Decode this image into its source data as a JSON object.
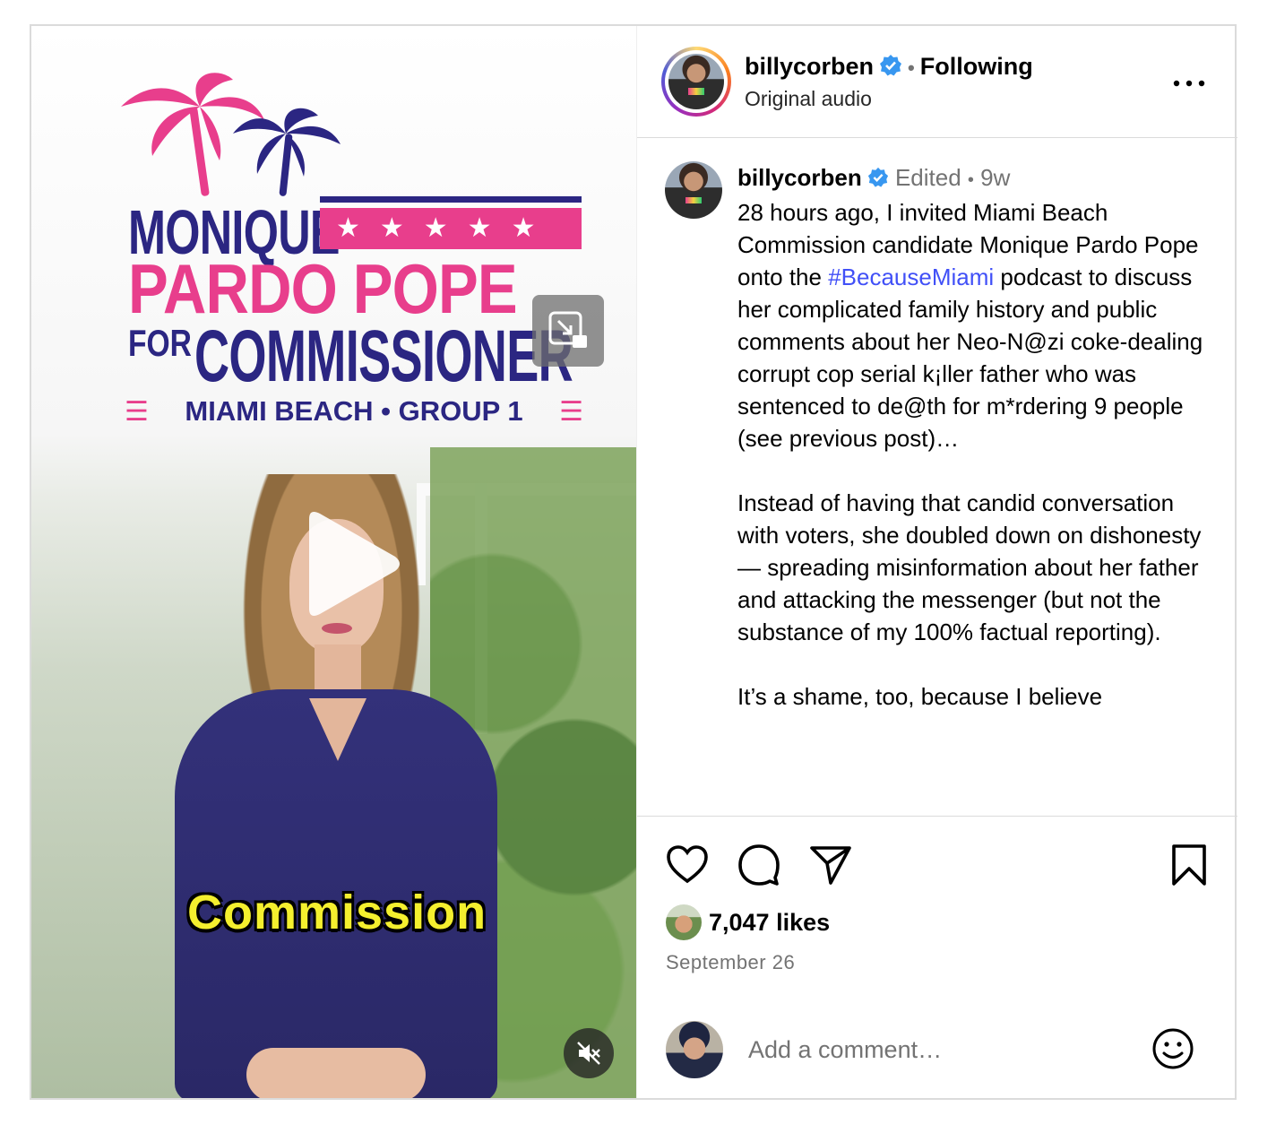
{
  "media": {
    "poster": {
      "line1": "MONIQUE",
      "stars": "★★★★★",
      "line2": "PARDO POPE",
      "line3a": "FOR",
      "line3b": "COMMISSIONER",
      "line4_left": "☰",
      "line4": "MIAMI BEACH • GROUP 1",
      "line4_right": "☰"
    },
    "caption_overlay": "Commission",
    "colors": {
      "navy": "#2b2682",
      "pink": "#e83e8c",
      "caption_yellow": "#f4ef2e"
    }
  },
  "header": {
    "username": "billycorben",
    "separator": "•",
    "follow_status": "Following",
    "audio": "Original audio",
    "more_icon": "more-horizontal-icon"
  },
  "caption": {
    "username": "billycorben",
    "edited": "Edited",
    "separator": "•",
    "age": "9w",
    "para1_before": "28 hours ago, I invited Miami Beach Commission candidate Monique Pardo Pope onto the ",
    "hashtag": "#BecauseMiami",
    "para1_after": " podcast to discuss her complicated family history and public comments about her Neo-N@zi coke-dealing corrupt cop serial k¡ller father who was sentenced to de@th for m*rdering 9 people (see previous post)…",
    "para2": "Instead of having that candid conversation with voters, she doubled down on dishonesty — spreading misinformation about her father and attacking the messenger (but not the substance of my 100% factual reporting).",
    "para3": "It’s a shame, too, because I believe"
  },
  "actions": {
    "like_icon": "heart-icon",
    "comment_icon": "comment-icon",
    "share_icon": "paper-plane-icon",
    "save_icon": "bookmark-icon",
    "likes": "7,047 likes",
    "date": "September 26"
  },
  "comment_box": {
    "placeholder": "Add a comment…",
    "emoji_icon": "smiley-icon"
  },
  "accent": {
    "verified_blue": "#3897f0",
    "link_blue": "#4150f7",
    "muted": "#737373"
  }
}
